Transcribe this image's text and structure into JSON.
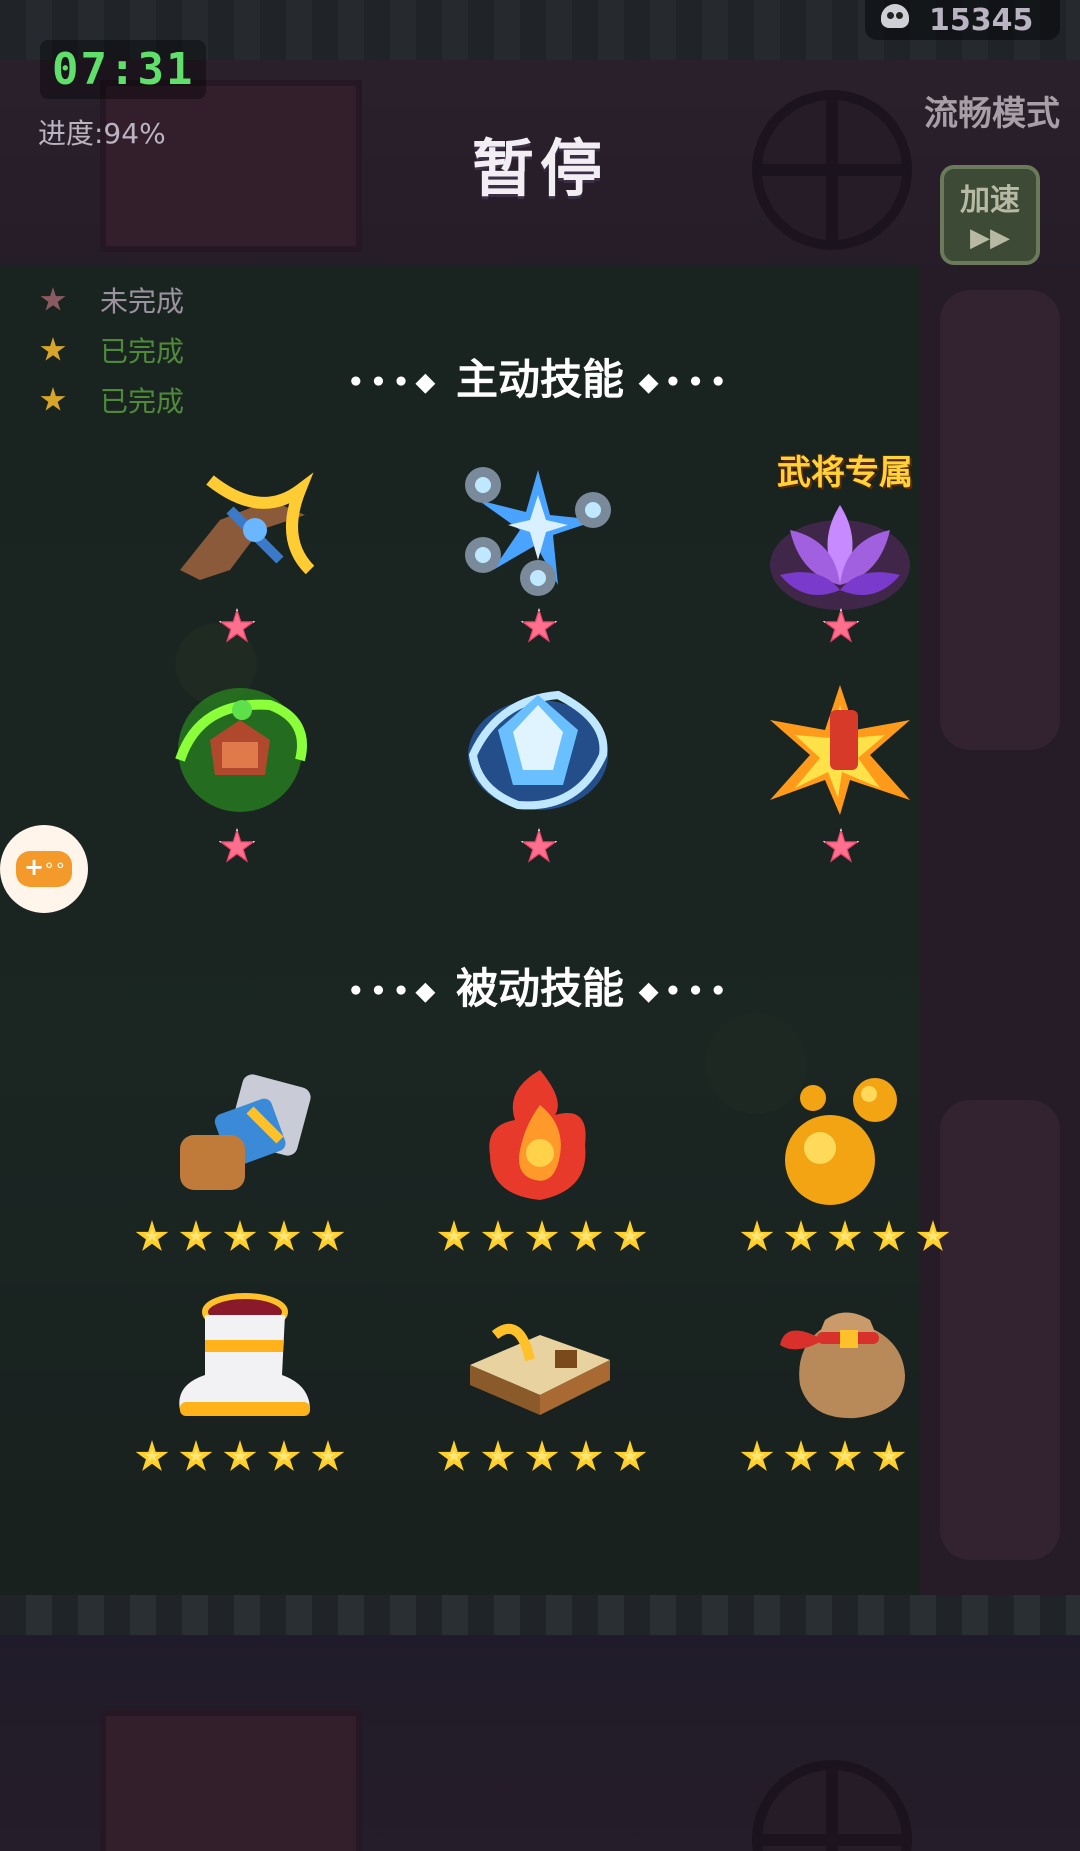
{
  "hud": {
    "timer": "07:31",
    "progress": "进度:94%",
    "kill_count": "15345",
    "mode_label": "流畅模式",
    "speed_button_label": "加速",
    "speed_button_icon": "fast-forward-icon"
  },
  "quests": [
    {
      "status": "未完成",
      "color": "#9a939f",
      "star_color": "#8a5a60"
    },
    {
      "status": "已完成",
      "color": "#4e8a3a",
      "star_color": "#d6a52a"
    },
    {
      "status": "已完成",
      "color": "#4e8a3a",
      "star_color": "#d6a52a"
    }
  ],
  "pause": {
    "title": "暂停",
    "active_title": "主动技能",
    "passive_title": "被动技能",
    "exclusive_label": "武将专属",
    "dots_left": "•••◆",
    "dots_right": "◆•••"
  },
  "active_skills": [
    {
      "icon": "golden-crossbow-icon",
      "stars": 1
    },
    {
      "icon": "ice-orb-shards-icon",
      "stars": 1
    },
    {
      "icon": "purple-lotus-icon",
      "stars": 1
    },
    {
      "icon": "green-whirlwind-icon",
      "stars": 1
    },
    {
      "icon": "ice-crystal-icon",
      "stars": 1
    },
    {
      "icon": "fire-explosion-icon",
      "stars": 1
    }
  ],
  "passive_skills": [
    {
      "icon": "gauntlet-icon",
      "stars": 5
    },
    {
      "icon": "fire-spirit-icon",
      "stars": 5
    },
    {
      "icon": "golden-orbs-icon",
      "stars": 5
    },
    {
      "icon": "boot-icon",
      "stars": 5
    },
    {
      "icon": "spell-book-icon",
      "stars": 5
    },
    {
      "icon": "loot-bag-icon",
      "stars": 4
    }
  ],
  "colors": {
    "accent_gold": "#ffcf2a",
    "accent_pink": "#e8466a",
    "timer_green": "#5fe06a"
  }
}
